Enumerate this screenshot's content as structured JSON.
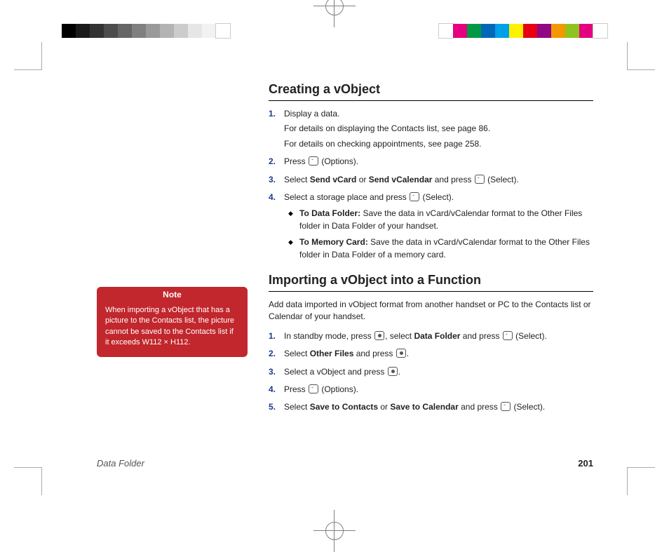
{
  "printer_marks": {
    "gray_swatches": [
      "#000000",
      "#1a1a1a",
      "#333333",
      "#4d4d4d",
      "#666666",
      "#808080",
      "#999999",
      "#b3b3b3",
      "#cccccc",
      "#e6e6e6",
      "#f2f2f2",
      "#ffffff"
    ],
    "color_swatches": [
      "#ffffff",
      "#e4007f",
      "#009944",
      "#0068b7",
      "#00a0e9",
      "#fff100",
      "#e60012",
      "#920783",
      "#f39800",
      "#8fc31f",
      "#e4007f",
      "#ffffff"
    ]
  },
  "sidebar": {
    "note_label": "Note",
    "note_text": "When importing a vObject that has a picture to the Contacts list, the picture cannot be saved to the Contacts list if it exceeds W112 × H112."
  },
  "section1": {
    "title": "Creating a vObject",
    "steps": [
      {
        "num": "1.",
        "text": "Display a data.",
        "sub": [
          "For details on displaying the Contacts list, see page 86.",
          "For details on checking appointments, see page 258."
        ]
      },
      {
        "num": "2.",
        "pre": "Press ",
        "icon": "soft-key",
        "post": " (Options)."
      },
      {
        "num": "3.",
        "segments": {
          "a": "Select ",
          "b": "Send vCard",
          "c": " or ",
          "d": "Send vCalendar",
          "e": " and press ",
          "f_icon": "soft-key",
          "g": " (Select)."
        }
      },
      {
        "num": "4.",
        "pre": "Select a storage place and press ",
        "icon": "soft-key",
        "post": " (Select).",
        "bullets": [
          {
            "label": "To Data Folder:",
            "text": " Save the data in vCard/vCalendar format to the Other Files folder in Data Folder of your handset."
          },
          {
            "label": "To Memory Card:",
            "text": " Save the data in vCard/vCalendar format to the Other Files folder in Data Folder of a memory card."
          }
        ]
      }
    ]
  },
  "section2": {
    "title": "Importing a vObject into a Function",
    "intro": "Add data imported in vObject format from another handset or PC to the Contacts list or Calendar of your handset.",
    "steps": [
      {
        "num": "1.",
        "segments": {
          "a": "In standby mode, press ",
          "b_icon": "center-key",
          "c": ", select ",
          "d": "Data Folder",
          "e": " and press ",
          "f_icon": "soft-key",
          "g": " (Select)."
        }
      },
      {
        "num": "2.",
        "segments": {
          "a": "Select ",
          "b": "Other Files",
          "c": " and press ",
          "d_icon": "center-key",
          "e": "."
        }
      },
      {
        "num": "3.",
        "segments": {
          "a": "Select a vObject and press ",
          "b_icon": "center-key",
          "c": "."
        }
      },
      {
        "num": "4.",
        "pre": "Press ",
        "icon": "soft-key",
        "post": " (Options)."
      },
      {
        "num": "5.",
        "segments": {
          "a": "Select ",
          "b": "Save to Contacts",
          "c": " or ",
          "d": "Save to Calendar",
          "e": " and press ",
          "f_icon": "soft-key",
          "g": " (Select)."
        }
      }
    ]
  },
  "footer": {
    "section": "Data Folder",
    "page": "201"
  }
}
